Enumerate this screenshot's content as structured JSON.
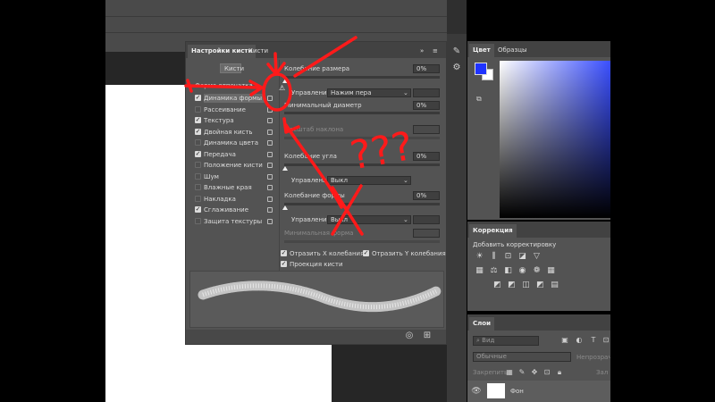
{
  "brush_panel": {
    "tabs": [
      "Настройки кисти",
      "Кисти"
    ],
    "brushes_button": "Кисти",
    "tip_shape": "Форма отпечатка",
    "options": [
      {
        "label": "Динамика формы",
        "checked": true,
        "lock": true
      },
      {
        "label": "Рассеивание",
        "checked": false,
        "lock": true
      },
      {
        "label": "Текстура",
        "checked": true,
        "lock": true
      },
      {
        "label": "Двойная кисть",
        "checked": true,
        "lock": true
      },
      {
        "label": "Динамика цвета",
        "checked": false,
        "lock": true
      },
      {
        "label": "Передача",
        "checked": true,
        "lock": true
      },
      {
        "label": "Положение кисти",
        "checked": false,
        "lock": true
      },
      {
        "label": "Шум",
        "checked": false,
        "lock": true
      },
      {
        "label": "Влажные края",
        "checked": false,
        "lock": true
      },
      {
        "label": "Накладка",
        "checked": false,
        "lock": true
      },
      {
        "label": "Сглаживание",
        "checked": true,
        "lock": true
      },
      {
        "label": "Защита текстуры",
        "checked": false,
        "lock": true
      }
    ],
    "size_jitter_label": "Колебание размера",
    "size_jitter_value": "0%",
    "control_label": "Управление:",
    "control_value": "Нажим пера",
    "min_diameter_label": "Минимальный диаметр",
    "min_diameter_value": "0%",
    "tilt_scale_label": "Масштаб наклона",
    "angle_jitter_label": "Колебание угла",
    "angle_jitter_value": "0%",
    "angle_control_label": "Управление:",
    "angle_control_value": "Выкл",
    "roundness_jitter_label": "Колебание формы",
    "roundness_jitter_value": "0%",
    "roundness_control_label": "Управление:",
    "roundness_control_value": "Выкл",
    "min_roundness_label": "Минимальная форма",
    "flip_x_label": "Отразить X колебания",
    "flip_y_label": "Отразить Y колебания",
    "brush_projection_label": "Проекция кисти"
  },
  "color_panel": {
    "tabs": [
      "Цвет",
      "Образцы"
    ],
    "foreground": "#1f33ff",
    "background": "#ffffff"
  },
  "adjustments_panel": {
    "tab": "Коррекция",
    "title": "Добавить корректировку"
  },
  "layers_panel": {
    "tab": "Слои",
    "filter_placeholder": "Вид",
    "blend_mode": "Обычные",
    "opacity_label": "Непрозрачн",
    "lock_label": "Закрепить:",
    "fill_label": "Зал",
    "layer_name": "Фон"
  },
  "annotation": {
    "question_marks": "???",
    "color": "#ff1a1a"
  }
}
